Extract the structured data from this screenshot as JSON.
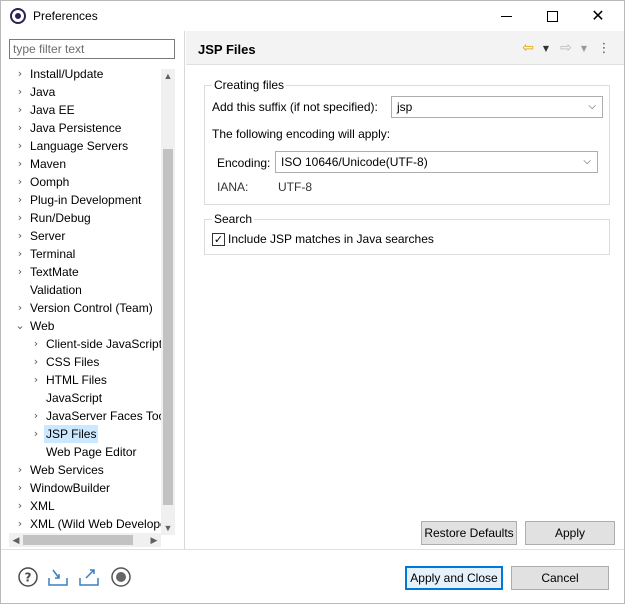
{
  "window": {
    "title": "Preferences"
  },
  "filter": {
    "placeholder": "type filter text",
    "value": ""
  },
  "tree": {
    "items": [
      {
        "label": "Install/Update",
        "level": 0,
        "expander": "collapsed"
      },
      {
        "label": "Java",
        "level": 0,
        "expander": "collapsed"
      },
      {
        "label": "Java EE",
        "level": 0,
        "expander": "collapsed"
      },
      {
        "label": "Java Persistence",
        "level": 0,
        "expander": "collapsed"
      },
      {
        "label": "Language Servers",
        "level": 0,
        "expander": "collapsed"
      },
      {
        "label": "Maven",
        "level": 0,
        "expander": "collapsed"
      },
      {
        "label": "Oomph",
        "level": 0,
        "expander": "collapsed"
      },
      {
        "label": "Plug-in Development",
        "level": 0,
        "expander": "collapsed"
      },
      {
        "label": "Run/Debug",
        "level": 0,
        "expander": "collapsed"
      },
      {
        "label": "Server",
        "level": 0,
        "expander": "collapsed"
      },
      {
        "label": "Terminal",
        "level": 0,
        "expander": "collapsed"
      },
      {
        "label": "TextMate",
        "level": 0,
        "expander": "collapsed"
      },
      {
        "label": "Validation",
        "level": 0,
        "expander": "none"
      },
      {
        "label": "Version Control (Team)",
        "level": 0,
        "expander": "collapsed"
      },
      {
        "label": "Web",
        "level": 0,
        "expander": "expanded"
      },
      {
        "label": "Client-side JavaScript",
        "level": 1,
        "expander": "collapsed"
      },
      {
        "label": "CSS Files",
        "level": 1,
        "expander": "collapsed"
      },
      {
        "label": "HTML Files",
        "level": 1,
        "expander": "collapsed"
      },
      {
        "label": "JavaScript",
        "level": 1,
        "expander": "none"
      },
      {
        "label": "JavaServer Faces Tools",
        "level": 1,
        "expander": "collapsed"
      },
      {
        "label": "JSP Files",
        "level": 1,
        "expander": "collapsed",
        "selected": true
      },
      {
        "label": "Web Page Editor",
        "level": 1,
        "expander": "none"
      },
      {
        "label": "Web Services",
        "level": 0,
        "expander": "collapsed"
      },
      {
        "label": "WindowBuilder",
        "level": 0,
        "expander": "collapsed"
      },
      {
        "label": "XML",
        "level": 0,
        "expander": "collapsed"
      },
      {
        "label": "XML (Wild Web Developer)",
        "level": 0,
        "expander": "collapsed"
      }
    ]
  },
  "page": {
    "title": "JSP Files",
    "creating_files": {
      "group_title": "Creating files",
      "suffix_label": "Add this suffix (if not specified):",
      "suffix_value": "jsp",
      "encoding_note": "The following encoding will apply:",
      "encoding_label": "Encoding:",
      "encoding_value": "ISO 10646/Unicode(UTF-8)",
      "iana_label": "IANA:",
      "iana_value": "UTF-8"
    },
    "search": {
      "group_title": "Search",
      "include_label": "Include JSP matches in Java searches",
      "include_checked": true
    },
    "restore_defaults_label": "Restore Defaults",
    "apply_label": "Apply"
  },
  "footer": {
    "apply_and_close_label": "Apply and Close",
    "cancel_label": "Cancel",
    "icons": [
      "help-icon",
      "import-icon",
      "export-icon",
      "record-icon"
    ]
  },
  "colors": {
    "selection": "#cce8ff",
    "default_button_border": "#0078d7",
    "back_arrow": "#e0a000"
  }
}
